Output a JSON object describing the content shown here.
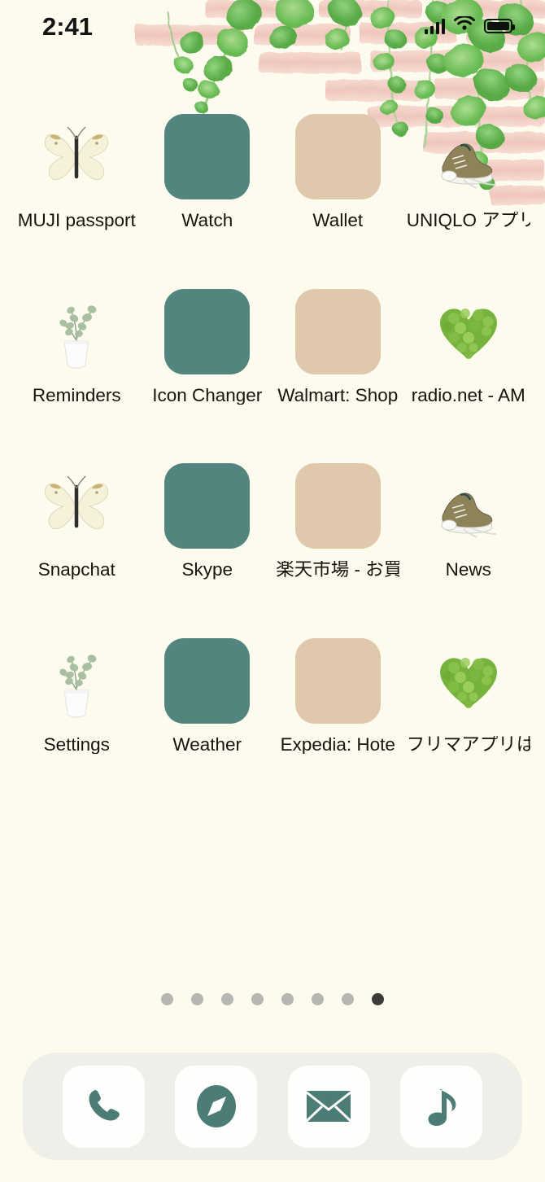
{
  "status_bar": {
    "time": "2:41",
    "signal_icon": "cellular-signal-icon",
    "signal_bars": 4,
    "wifi_icon": "wifi-icon",
    "battery_icon": "battery-full-icon"
  },
  "colors": {
    "background": "#FDFBEE",
    "teal_tile": "#51857E",
    "beige_tile": "#E0C8AC",
    "dock_background": "#EDEFE8",
    "dock_tile": "#FEFEFC",
    "label_text": "#17130E",
    "dot_inactive": "#B6B6B2",
    "dot_active": "#3A3A38",
    "brick_pink": "#F0C9C0",
    "leaf_green": "#63B450"
  },
  "home_screen": {
    "apps": [
      {
        "label": "MUJI passport",
        "icon": "butterfly-icon",
        "style": "photo"
      },
      {
        "label": "Watch",
        "icon": "teal-solid-tile",
        "style": "teal"
      },
      {
        "label": "Wallet",
        "icon": "beige-solid-tile",
        "style": "beige"
      },
      {
        "label": "UNIQLO アプリ",
        "icon": "sneakers-icon",
        "style": "photo"
      },
      {
        "label": "Reminders",
        "icon": "plant-vase-icon",
        "style": "photo"
      },
      {
        "label": "Icon Changer",
        "icon": "teal-solid-tile",
        "style": "teal"
      },
      {
        "label": "Walmart: Shop",
        "icon": "beige-solid-tile",
        "style": "beige"
      },
      {
        "label": "radio.net - AM",
        "icon": "green-heart-icon",
        "style": "photo"
      },
      {
        "label": "Snapchat",
        "icon": "butterfly-icon",
        "style": "photo"
      },
      {
        "label": "Skype",
        "icon": "teal-solid-tile",
        "style": "teal"
      },
      {
        "label": "楽天市場 - お買い",
        "icon": "beige-solid-tile",
        "style": "beige"
      },
      {
        "label": "News",
        "icon": "sneakers-icon",
        "style": "photo"
      },
      {
        "label": "Settings",
        "icon": "plant-vase-icon",
        "style": "photo"
      },
      {
        "label": "Weather",
        "icon": "teal-solid-tile",
        "style": "teal"
      },
      {
        "label": "Expedia: Hote",
        "icon": "beige-solid-tile",
        "style": "beige"
      },
      {
        "label": "フリマアプリは",
        "icon": "green-heart-icon",
        "style": "photo"
      }
    ]
  },
  "page_indicator": {
    "total": 8,
    "active_index": 8
  },
  "dock": {
    "apps": [
      {
        "icon": "phone-icon"
      },
      {
        "icon": "compass-safari-icon"
      },
      {
        "icon": "envelope-mail-icon"
      },
      {
        "icon": "music-note-icon"
      }
    ]
  },
  "wallpaper": {
    "description": "watercolor pink brick wall with hanging green ivy vines"
  }
}
